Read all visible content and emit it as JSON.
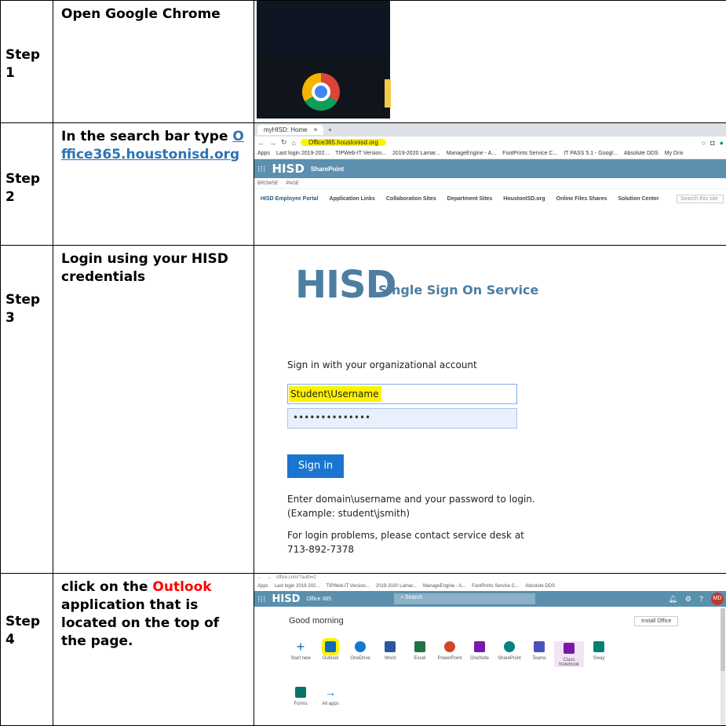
{
  "steps": [
    {
      "label": "Step 1",
      "line1": "Open Google Chrome"
    },
    {
      "label": "Step 2",
      "text": "In the search bar type ",
      "link": "Office365.houstonisd.org"
    },
    {
      "label": "Step 3",
      "text": "Login using your HISD credentials"
    },
    {
      "label": "Step 4",
      "pre": "click on the ",
      "highlight": "Outlook",
      "post": " application that is located on the top of the page."
    }
  ],
  "browser": {
    "tab_title": "myHISD: Home",
    "url": "Office365.houstonisd.org",
    "bookmarks": [
      "Apps",
      "Last login 2019-202...",
      "TIPWeb-IT Version...",
      "2019-2020 Lamar...",
      "ManageEngine - A...",
      "FootPrints Service C...",
      "IT PASS 5.1 - Googl...",
      "Absolute DDS",
      "My Driv"
    ],
    "brand": "HISD",
    "sharepoint": "SharePoint",
    "ribbon": [
      "BROWSE",
      "PAGE"
    ],
    "nav": [
      "HISD Employee Portal",
      "Application Links",
      "Collaboration Sites",
      "Department Sites",
      "HoustonISD.org",
      "Online Files Shares",
      "Solution Center"
    ],
    "search_placeholder": "Search this site"
  },
  "signin": {
    "logo": "HISD",
    "service": "Single Sign On Service",
    "prompt": "Sign in with your organizational account",
    "username": "Student\\Username",
    "password": "••••••••••••••",
    "button": "Sign in",
    "help1": "Enter domain\\username and your password to login. (Example: student\\jsmith)",
    "help2": "For login problems, please contact service desk at 713-892-7378"
  },
  "office": {
    "url": "office.com/?auth=2",
    "brand": "HISD",
    "suite": "Office 365",
    "search": "Search",
    "greeting": "Good morning",
    "install": "Install Office",
    "avatar": "MD",
    "apps": [
      "Start new",
      "Outlook",
      "OneDrive",
      "Word",
      "Excel",
      "PowerPoint",
      "OneNote",
      "SharePoint",
      "Teams",
      "Class Notebook",
      "Sway"
    ],
    "apps2": [
      "Forms",
      "All apps"
    ]
  },
  "colors": {
    "link": "#2e74b5",
    "highlight": "#fff200",
    "red": "#ff0000",
    "hisd_blue": "#4c7ea1"
  }
}
